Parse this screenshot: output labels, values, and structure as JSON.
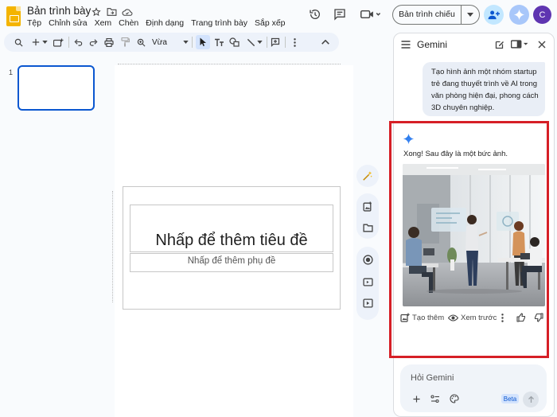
{
  "app": {
    "doc_title": "Bản trình bày",
    "menu": [
      "Tệp",
      "Chỉnh sửa",
      "Xem",
      "Chèn",
      "Định dạng",
      "Trang trình bày",
      "Sắp xếp"
    ],
    "present_label": "Bản trình chiếu",
    "avatar_initial": "C"
  },
  "toolbar": {
    "zoom": "Vừa"
  },
  "filmstrip": {
    "slide_number": "1"
  },
  "slide": {
    "title_placeholder": "Nhấp để thêm tiêu đề",
    "subtitle_placeholder": "Nhấp để thêm phụ đề"
  },
  "gemini": {
    "title": "Gemini",
    "user_message": "Tạo hình ảnh một nhóm startup trẻ đang thuyết trình về AI trong văn phòng hiện đại, phong cách 3D chuyên nghiệp.",
    "reply": "Xong! Sau đây là một bức ảnh.",
    "actions": {
      "create_more": "Tạo thêm",
      "preview": "Xem trước"
    },
    "input_placeholder": "Hỏi Gemini",
    "beta_label": "Beta"
  },
  "colors": {
    "accent": "#0b57d0",
    "highlight": "#d61f26",
    "logo": "#f4b400"
  }
}
